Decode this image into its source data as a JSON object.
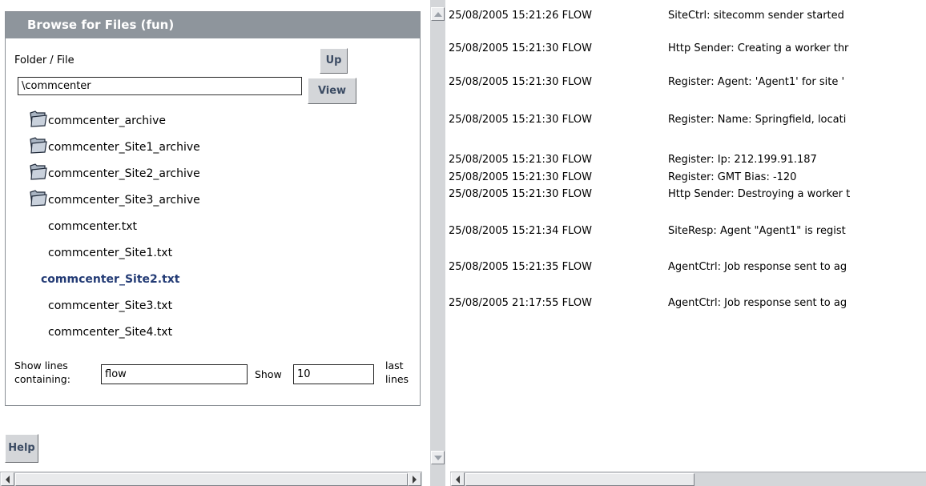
{
  "panel": {
    "title": "Browse for Files (fun)",
    "folder_label": "Folder / File",
    "up_label": "Up",
    "path_value": "\\commcenter",
    "view_label": "View"
  },
  "folders": [
    {
      "name": "commcenter_archive",
      "icon": "folder-icon"
    },
    {
      "name": "commcenter_Site1_archive",
      "icon": "folder-icon"
    },
    {
      "name": "commcenter_Site2_archive",
      "icon": "folder-icon"
    },
    {
      "name": "commcenter_Site3_archive",
      "icon": "folder-icon"
    }
  ],
  "files": [
    {
      "name": "commcenter.txt"
    },
    {
      "name": "commcenter_Site1.txt"
    },
    {
      "name": "commcenter_Site2.txt",
      "selected": true
    },
    {
      "name": "commcenter_Site3.txt"
    },
    {
      "name": "commcenter_Site4.txt"
    }
  ],
  "filter": {
    "show_lines_label_1": "Show lines",
    "show_lines_label_2": "containing:",
    "filter_value": "flow",
    "show_label": "Show",
    "count_value": "10",
    "last_label_1": "last",
    "last_label_2": "lines"
  },
  "help_label": "Help",
  "log": [
    {
      "timestamp": "25/08/2005 15:21:26 FLOW",
      "message": "SiteCtrl: sitecomm sender started"
    },
    {
      "timestamp": "25/08/2005 15:21:30 FLOW",
      "message": "Http Sender: Creating a worker thr"
    },
    {
      "timestamp": "25/08/2005 15:21:30 FLOW",
      "message": "Register: Agent: 'Agent1' for site '"
    },
    {
      "timestamp": "25/08/2005 15:21:30 FLOW",
      "message": "Register: Name: Springfield, locati"
    },
    {
      "timestamp": "25/08/2005 15:21:30 FLOW",
      "message": "Register: Ip: 212.199.91.187"
    },
    {
      "timestamp": "25/08/2005 15:21:30 FLOW",
      "message": "Register: GMT Bias: -120"
    },
    {
      "timestamp": "25/08/2005 15:21:30 FLOW",
      "message": "Http Sender: Destroying a worker t"
    },
    {
      "timestamp": "25/08/2005 15:21:34 FLOW",
      "message": "SiteResp: Agent \"Agent1\" is regist"
    },
    {
      "timestamp": "25/08/2005 15:21:35 FLOW",
      "message": "AgentCtrl: Job response sent to ag"
    },
    {
      "timestamp": "25/08/2005 21:17:55 FLOW",
      "message": "AgentCtrl: Job response sent to ag"
    }
  ],
  "colors": {
    "header_bg": "#8e959c",
    "selected_file": "#233b75",
    "button_bg": "#d4d6d9"
  }
}
